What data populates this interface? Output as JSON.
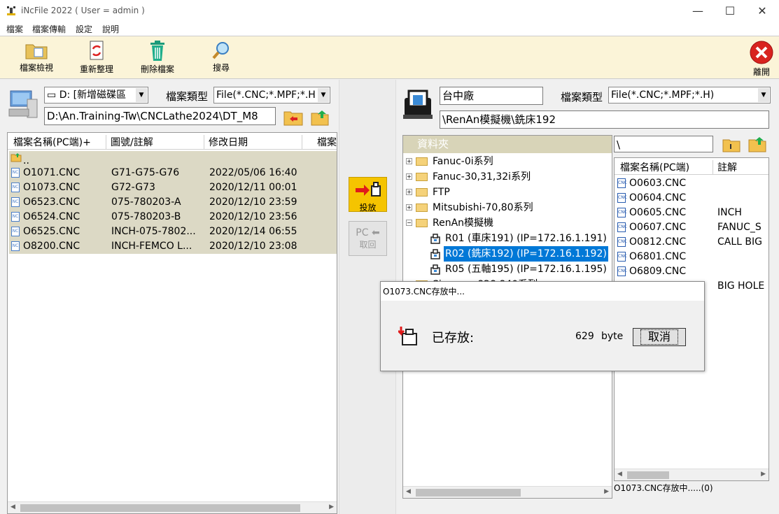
{
  "window": {
    "title": "iNcFile 2022 ( User = admin )"
  },
  "menu": [
    "檔案",
    "檔案傳輸",
    "設定",
    "說明"
  ],
  "toolbar": {
    "file_view": "檔案檢視",
    "refresh": "重新整理",
    "delete": "刪除檔案",
    "search": "搜尋",
    "exit": "離開"
  },
  "left": {
    "drive": "D: [新增磁碟區",
    "file_type_label": "檔案類型",
    "file_type": "File(*.CNC;*.MPF;*.H",
    "path": "D:\\An.Training-Tw\\CNCLathe2024\\DT_M8",
    "columns": [
      "檔案名稱(PC端)+",
      "圖號/註解",
      "修改日期",
      "檔案"
    ],
    "parent": "..",
    "files": [
      {
        "name": "O1071.CNC",
        "note": "G71-G75-G76",
        "date": "2022/05/06 16:40"
      },
      {
        "name": "O1073.CNC",
        "note": "G72-G73",
        "date": "2020/12/11 00:01"
      },
      {
        "name": "O6523.CNC",
        "note": "075-780203-A",
        "date": "2020/12/10 23:59"
      },
      {
        "name": "O6524.CNC",
        "note": "075-780203-B",
        "date": "2020/12/10 23:56"
      },
      {
        "name": "O6525.CNC",
        "note": "INCH-075-7802...",
        "date": "2020/12/14 06:55"
      },
      {
        "name": "O8200.CNC",
        "note": "INCH-FEMCO L...",
        "date": "2020/12/10 23:08"
      }
    ]
  },
  "middle": {
    "send": "投放",
    "receive_top": "PC",
    "receive": "取回"
  },
  "right": {
    "factory": "台中廠",
    "file_type_label": "檔案類型",
    "file_type": "File(*.CNC;*.MPF;*.H)",
    "machine_path": "\\RenAn模擬機\\銑床192",
    "tree_header": "資料夾",
    "tree": [
      {
        "label": "Fanuc-0i系列",
        "type": "folder",
        "exp": "+"
      },
      {
        "label": "Fanuc-30,31,32i系列",
        "type": "folder",
        "exp": "+"
      },
      {
        "label": "FTP",
        "type": "folder",
        "exp": "+"
      },
      {
        "label": "Mitsubishi-70,80系列",
        "type": "folder",
        "exp": "+"
      },
      {
        "label": "RenAn模擬機",
        "type": "folder-open",
        "exp": "−"
      },
      {
        "label": "R01 (車床191) (IP=172.16.1.191)",
        "type": "machine"
      },
      {
        "label": "R02 (銑床192) (IP=172.16.1.192)",
        "type": "machine",
        "selected": true
      },
      {
        "label": "R05 (五軸195) (IP=172.16.1.195)",
        "type": "machine"
      },
      {
        "label": "Siemens 828 840系列",
        "type": "folder",
        "exp": "+"
      }
    ],
    "search_path": "\\",
    "columns": [
      "檔案名稱(PC端)",
      "註解"
    ],
    "files": [
      {
        "name": "O0603.CNC",
        "note": ""
      },
      {
        "name": "O0604.CNC",
        "note": ""
      },
      {
        "name": "O0605.CNC",
        "note": "INCH"
      },
      {
        "name": "O0607.CNC",
        "note": "FANUC_S"
      },
      {
        "name": "O0812.CNC",
        "note": "CALL BIG"
      },
      {
        "name": "O6801.CNC",
        "note": ""
      },
      {
        "name": "O6809.CNC",
        "note": ""
      },
      {
        "name": "",
        "note": "BIG HOLE"
      }
    ],
    "status": "O1073.CNC存放中.....(0)"
  },
  "dialog": {
    "title": "O1073.CNC存放中...",
    "status": "已存放:",
    "bytes": "629",
    "unit": "byte",
    "cancel": "取消"
  },
  "colors": {
    "toolbar_bg": "#fbf4d8",
    "row_highlight": "#dcd9c5",
    "selection": "#0078d7",
    "send_button": "#f5c400"
  }
}
